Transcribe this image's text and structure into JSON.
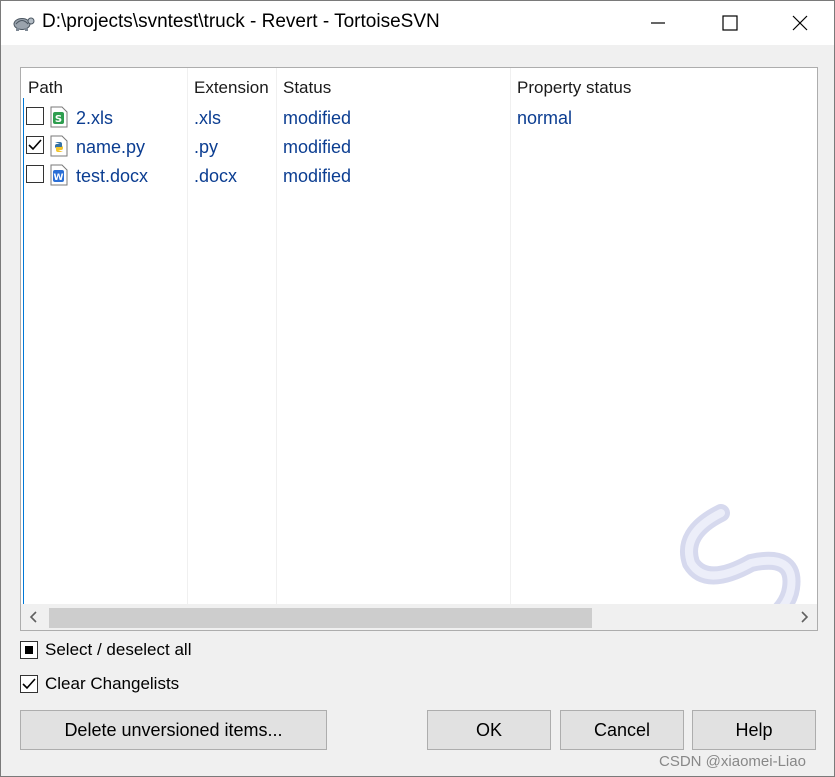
{
  "window": {
    "title": "D:\\projects\\svntest\\truck - Revert - TortoiseSVN",
    "app_icon": "tortoise-icon"
  },
  "controls": {
    "minimize_icon": "minimize-icon",
    "maximize_icon": "maximize-icon",
    "close_icon": "close-icon"
  },
  "columns": [
    "Path",
    "Extension",
    "Status",
    "Property status"
  ],
  "rows": [
    {
      "checked": false,
      "icon": "spreadsheet-file-icon",
      "path": "2.xls",
      "extension": ".xls",
      "status": "modified",
      "property_status": "normal"
    },
    {
      "checked": true,
      "icon": "python-file-icon",
      "path": "name.py",
      "extension": ".py",
      "status": "modified",
      "property_status": ""
    },
    {
      "checked": false,
      "icon": "word-file-icon",
      "path": "test.docx",
      "extension": ".docx",
      "status": "modified",
      "property_status": ""
    }
  ],
  "options": {
    "select_all_label": "Select / deselect all",
    "select_all_state": "indeterminate",
    "clear_changelists_label": "Clear Changelists",
    "clear_changelists_checked": true
  },
  "buttons": {
    "delete_unversioned": "Delete unversioned items...",
    "ok": "OK",
    "cancel": "Cancel",
    "help": "Help"
  },
  "watermark": "CSDN @xiaomei-Liao",
  "colors": {
    "item_text": "#0b3d91",
    "accent": "#0078d7"
  }
}
